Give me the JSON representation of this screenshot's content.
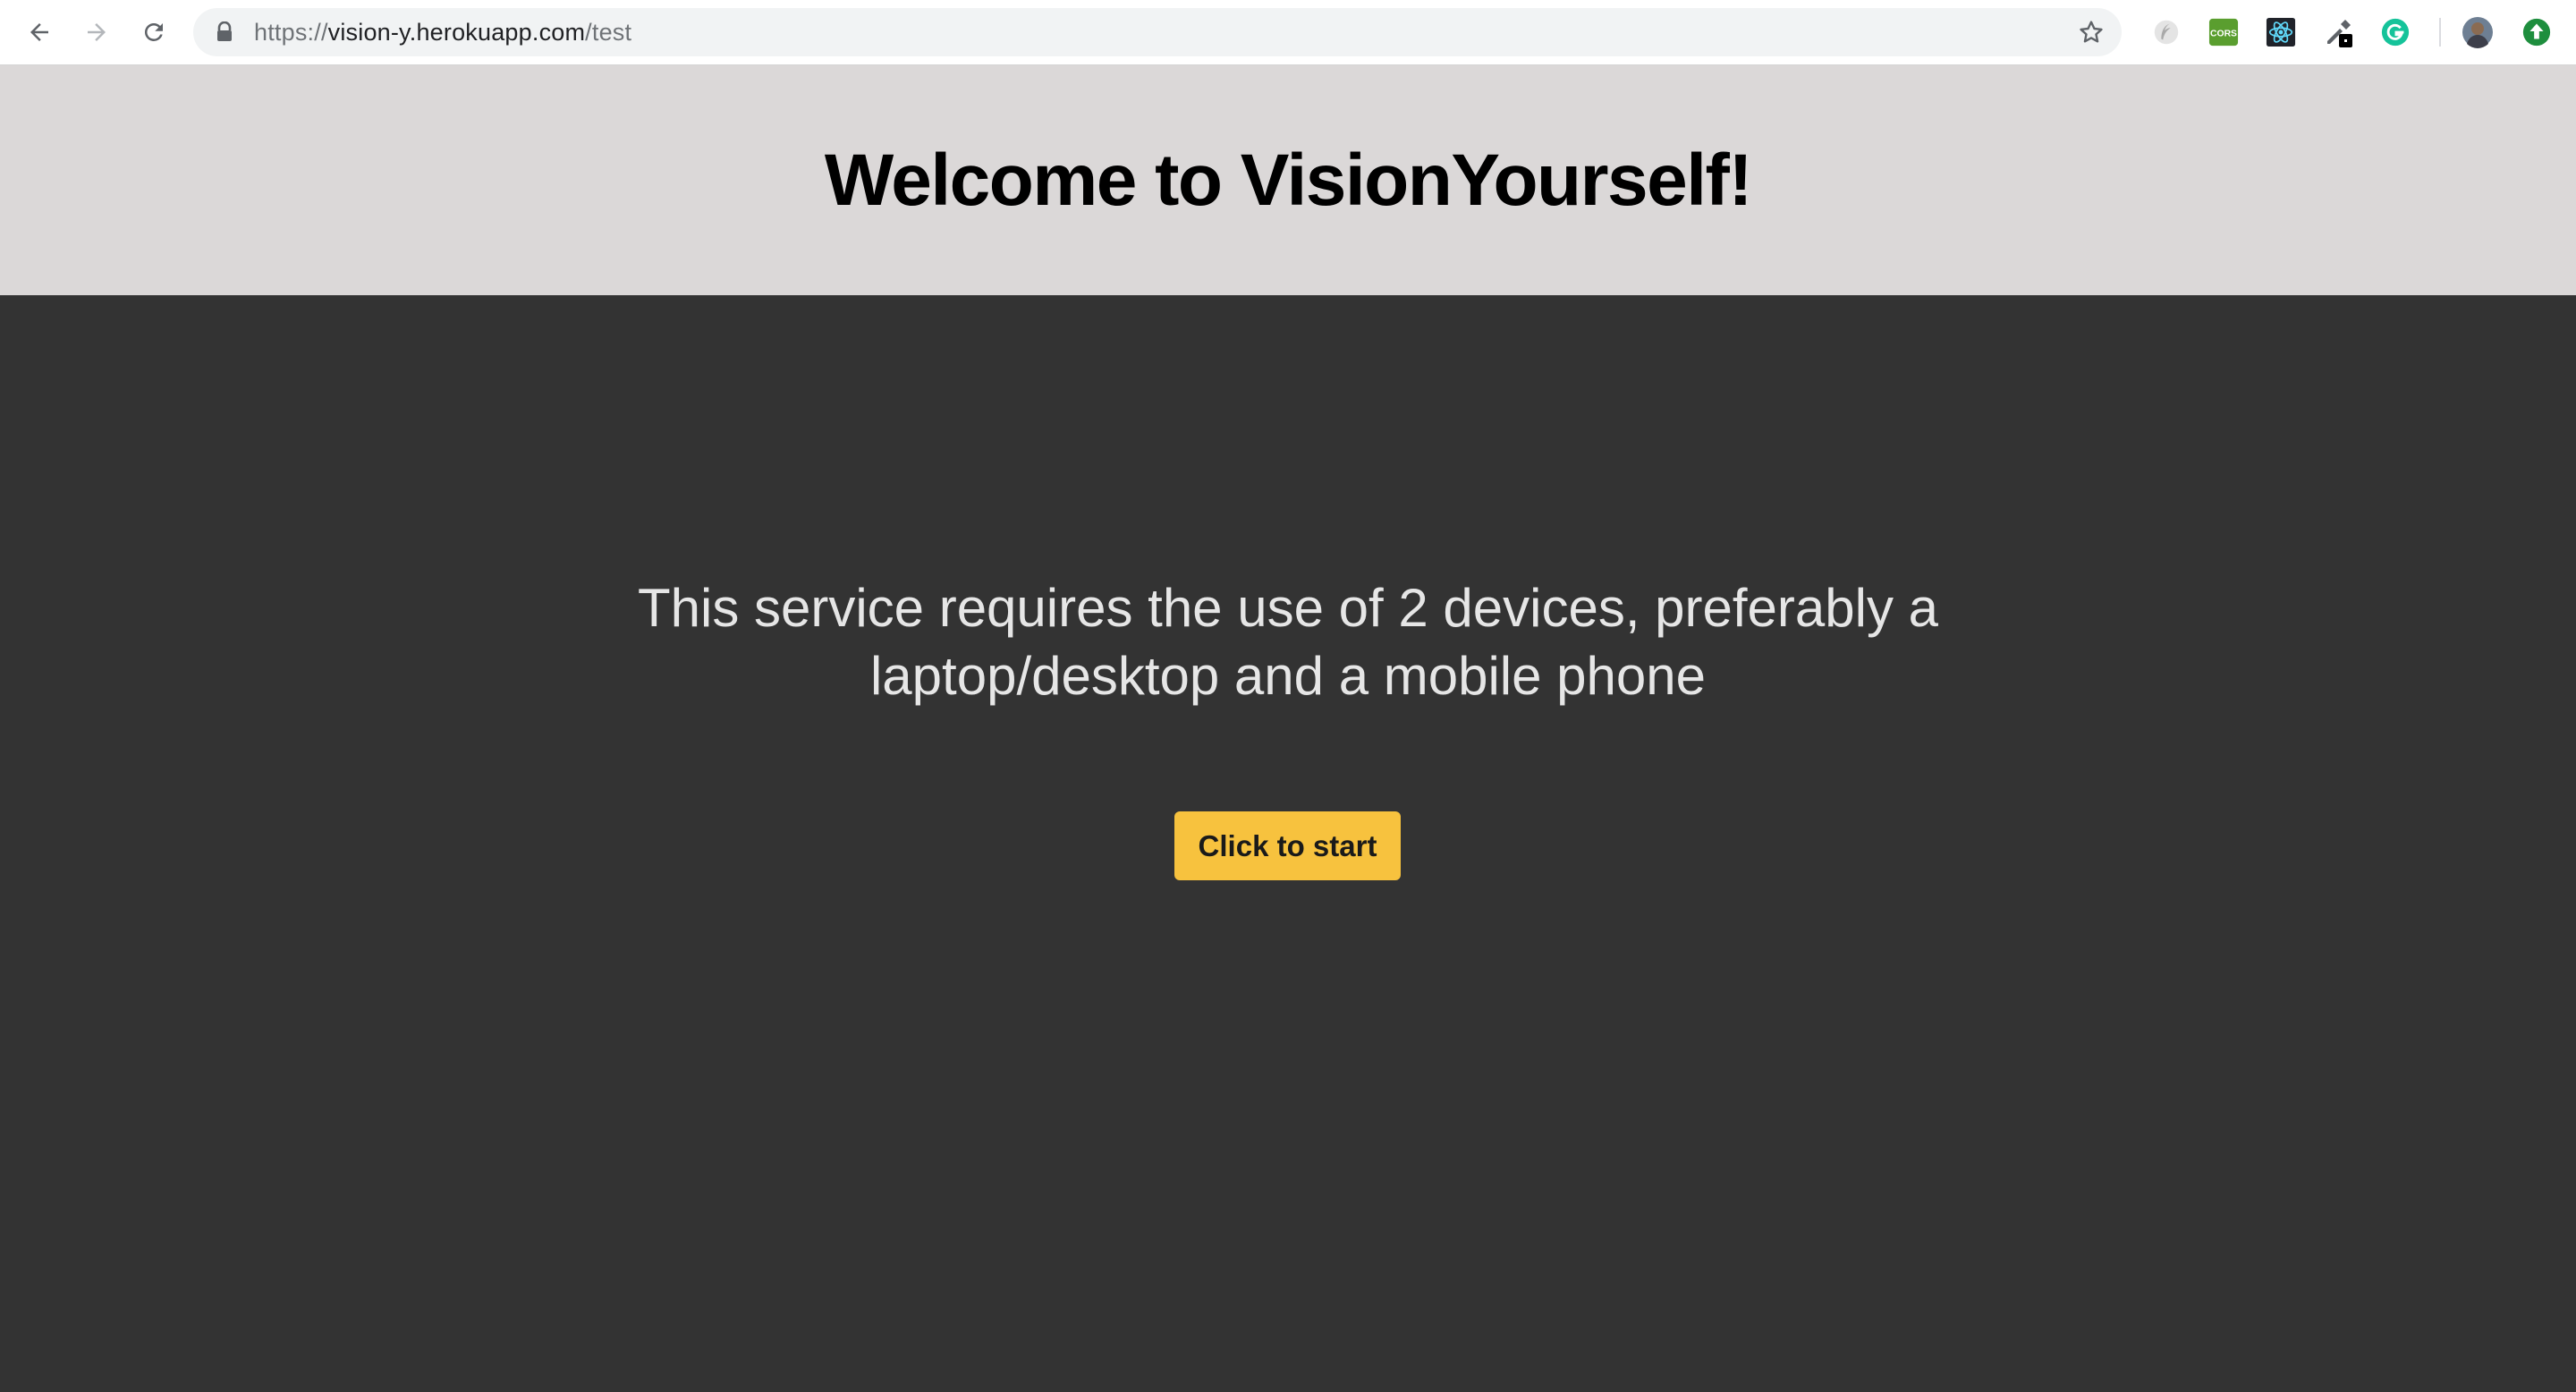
{
  "browser": {
    "url_scheme": "https://",
    "url_host": "vision-y.herokuapp.com",
    "url_path": "/test",
    "extensions": [
      {
        "name": "feather-icon",
        "color": "#c8c8c8"
      },
      {
        "name": "cors-icon",
        "label": "CORS",
        "color": "#5a9e2f"
      },
      {
        "name": "react-devtools-icon",
        "color": "#61dafb"
      },
      {
        "name": "color-picker-icon",
        "color": "#5f6368"
      },
      {
        "name": "grammarly-icon",
        "color": "#15c39a"
      },
      {
        "name": "avatar",
        "color": "#7a6a5c"
      },
      {
        "name": "update-icon",
        "color": "#1e8e3e"
      }
    ]
  },
  "header": {
    "title": "Welcome to VisionYourself!",
    "background": "#dbd8d8"
  },
  "main": {
    "notice": "This service requires the use of 2 devices, preferably a laptop/desktop and a mobile phone",
    "start_label": "Click to start",
    "background": "#333333",
    "accent": "#f7c23e"
  }
}
